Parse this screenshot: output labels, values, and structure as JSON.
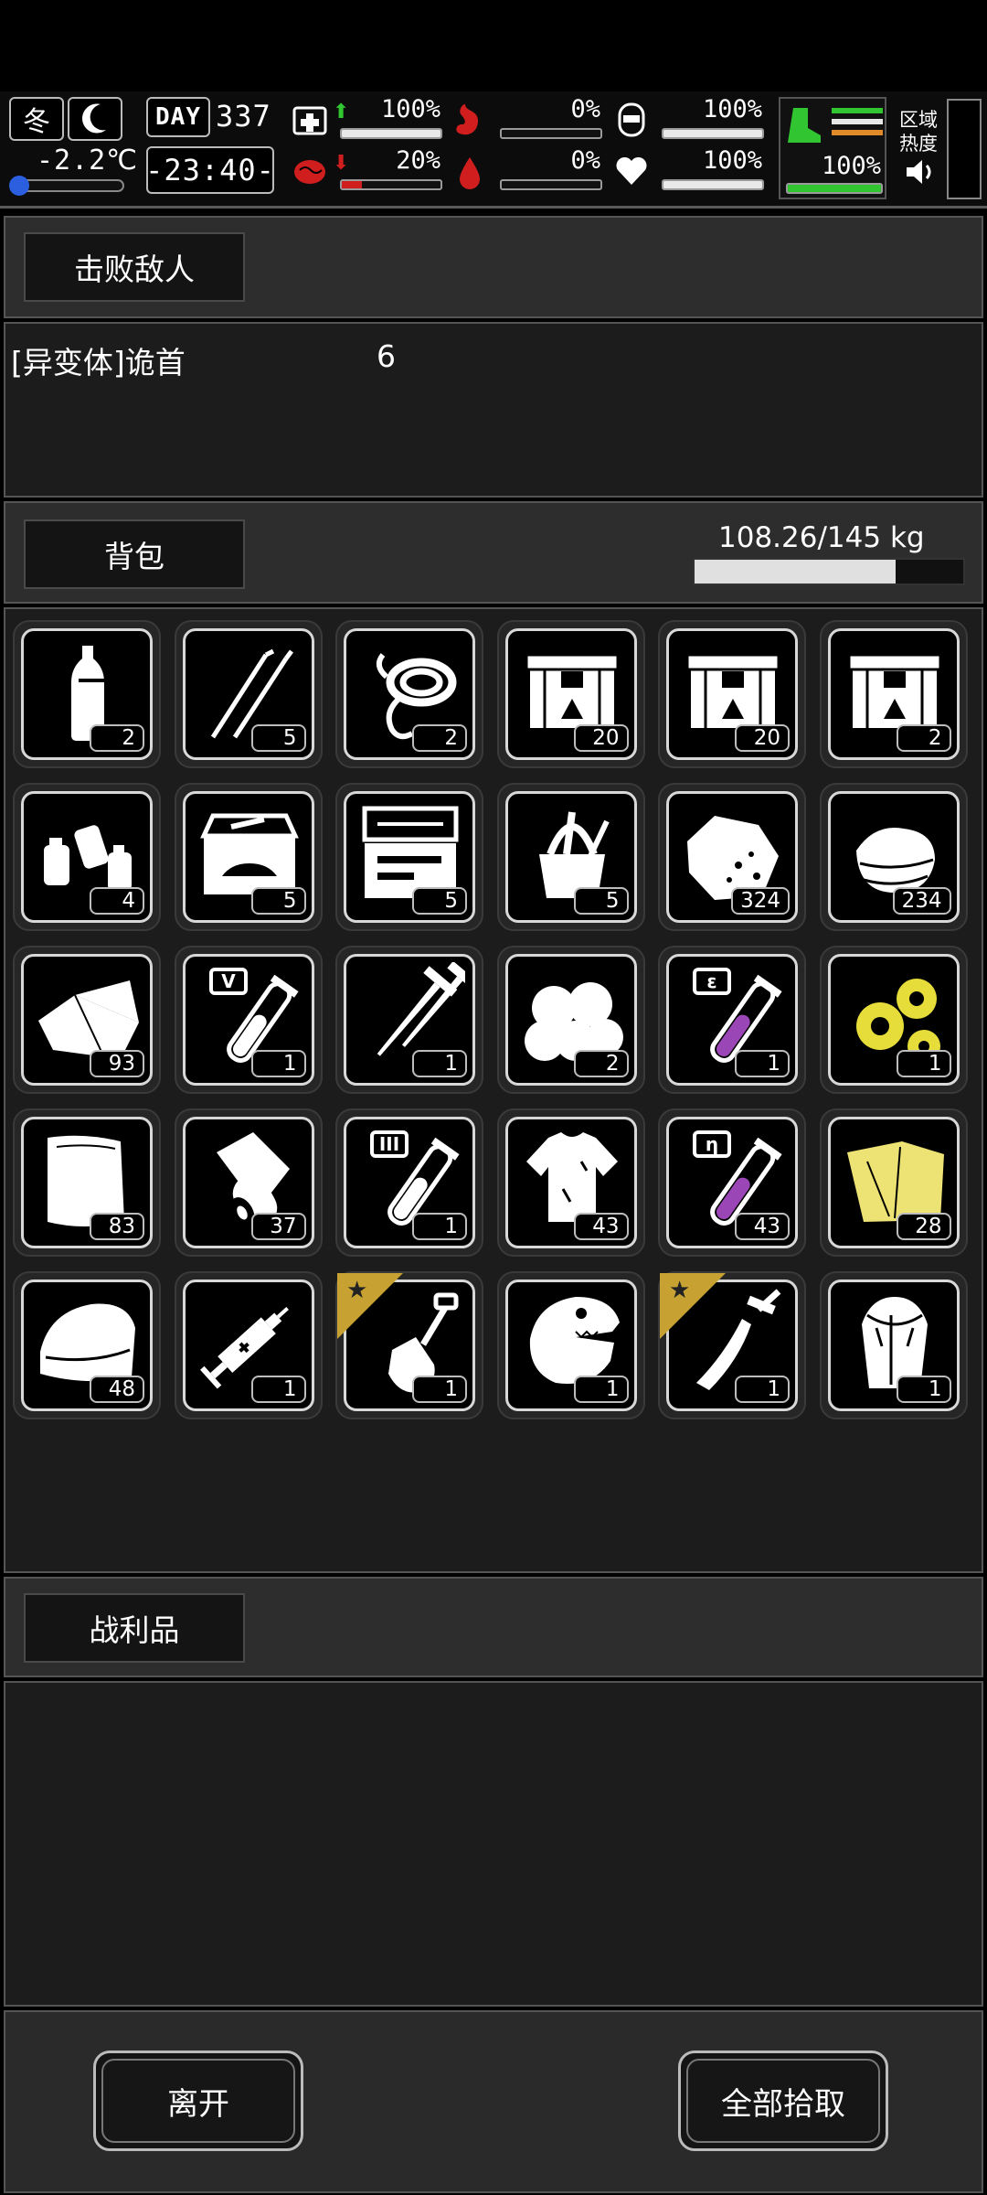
{
  "hud": {
    "season": "冬",
    "temperature": "-2.2℃",
    "day_label": "DAY",
    "day_number": "337",
    "clock": "-23:40-",
    "stats": [
      {
        "name": "health",
        "icon": "first-aid-icon",
        "value": "100%",
        "level": 1.0,
        "trend": "up",
        "color": "#e8e8e8"
      },
      {
        "name": "hunger",
        "icon": "stomach-icon",
        "value": "0%",
        "level": 0.0,
        "trend": "",
        "color": "#e8e8e8"
      },
      {
        "name": "armor",
        "icon": "shield-helmet-icon",
        "value": "100%",
        "level": 1.0,
        "trend": "",
        "color": "#e8e8e8"
      },
      {
        "name": "infection",
        "icon": "brain-icon",
        "value": "20%",
        "level": 0.2,
        "trend": "down",
        "color": "#d01e1e"
      },
      {
        "name": "thirst",
        "icon": "blood-drop-icon",
        "value": "0%",
        "level": 0.0,
        "trend": "",
        "color": "#e8e8e8"
      },
      {
        "name": "mood",
        "icon": "heart-icon",
        "value": "100%",
        "level": 1.0,
        "trend": "",
        "color": "#e8e8e8"
      }
    ],
    "stamina": {
      "value": "100%",
      "level": 1.0,
      "color": "#31c631"
    },
    "zone_label_1": "区域",
    "zone_label_2": "热度"
  },
  "defeated": {
    "title": "击败敌人",
    "enemy_name": "[异变体]诡首",
    "enemy_count": "6"
  },
  "backpack": {
    "title": "背包",
    "weight": "108.26/145 kg",
    "weight_fraction": 0.747,
    "items": [
      {
        "icon": "water-bottle-icon",
        "count": "2"
      },
      {
        "icon": "lockpick-icon",
        "count": "5"
      },
      {
        "icon": "rope-hook-icon",
        "count": "2"
      },
      {
        "icon": "supply-crate-icon",
        "count": "20"
      },
      {
        "icon": "supply-crate-icon",
        "count": "20"
      },
      {
        "icon": "supply-crate-icon",
        "count": "2"
      },
      {
        "icon": "spray-cans-icon",
        "count": "4"
      },
      {
        "icon": "car-toolbox-icon",
        "count": "5"
      },
      {
        "icon": "precision-toolkit-icon",
        "count": "5"
      },
      {
        "icon": "tool-bag-icon",
        "count": "5"
      },
      {
        "icon": "ore-rock-icon",
        "count": "324"
      },
      {
        "icon": "cloth-pile-icon",
        "count": "234"
      },
      {
        "icon": "cloth-scraps-icon",
        "count": "93"
      },
      {
        "icon": "test-tube-icon",
        "count": "1",
        "tube_label": "V",
        "tube_color": "#ffffff"
      },
      {
        "icon": "nails-icon",
        "count": "1"
      },
      {
        "icon": "cotton-balls-icon",
        "count": "2"
      },
      {
        "icon": "test-tube-icon",
        "count": "1",
        "tube_label": "ε",
        "tube_color": "#9b46b6"
      },
      {
        "icon": "gears-icon",
        "count": "1"
      },
      {
        "icon": "fabric-sheet-icon",
        "count": "83"
      },
      {
        "icon": "bandage-roll-icon",
        "count": "37"
      },
      {
        "icon": "test-tube-icon",
        "count": "1",
        "tube_label": "III",
        "tube_color": "#ffffff"
      },
      {
        "icon": "torn-shirt-icon",
        "count": "43"
      },
      {
        "icon": "test-tube-icon",
        "count": "43",
        "tube_label": "η",
        "tube_color": "#9b46b6"
      },
      {
        "icon": "gold-cloth-icon",
        "count": "28"
      },
      {
        "icon": "folded-towel-icon",
        "count": "48"
      },
      {
        "icon": "syringe-icon",
        "count": "1"
      },
      {
        "icon": "shovel-icon",
        "count": "1",
        "starred": true
      },
      {
        "icon": "dinosaur-head-icon",
        "count": "1"
      },
      {
        "icon": "machete-icon",
        "count": "1",
        "starred": true
      },
      {
        "icon": "fur-vest-icon",
        "count": "1"
      }
    ]
  },
  "loot": {
    "title": "战利品"
  },
  "actions": {
    "leave": "离开",
    "pick_all": "全部拾取"
  }
}
